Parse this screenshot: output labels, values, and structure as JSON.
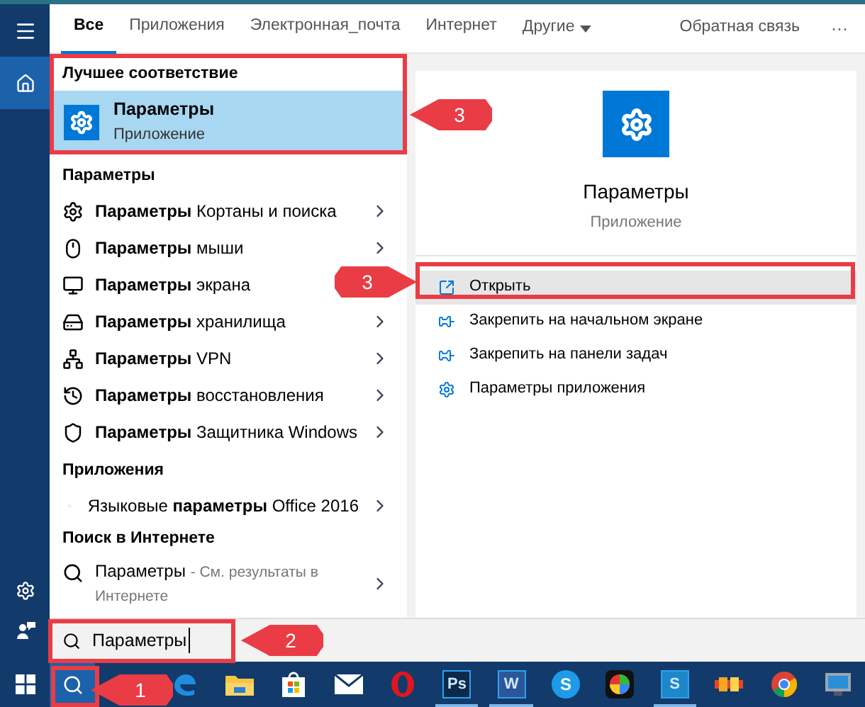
{
  "tabs": [
    {
      "label": "Все",
      "selected": true
    },
    {
      "label": "Приложения",
      "selected": false
    },
    {
      "label": "Электронная_почта",
      "selected": false
    },
    {
      "label": "Интернет",
      "selected": false
    }
  ],
  "more_tab": {
    "label": "Другие"
  },
  "feedback": {
    "label": "Обратная связь"
  },
  "overflow": {
    "label": "···"
  },
  "best_match": {
    "heading": "Лучшее соответствие",
    "title": "Параметры",
    "subtitle": "Приложение",
    "selected": true
  },
  "settings_section": {
    "heading": "Параметры",
    "items": [
      {
        "kind": "gear",
        "text": "**Параметры** Кортаны и поиска"
      },
      {
        "kind": "mouse",
        "text": "**Параметры** мыши"
      },
      {
        "kind": "monitor",
        "text": "**Параметры** экрана"
      },
      {
        "kind": "drive",
        "text": "**Параметры** хранилища"
      },
      {
        "kind": "vpn",
        "text": "**Параметры** VPN"
      },
      {
        "kind": "history",
        "text": "**Параметры** восстановления"
      },
      {
        "kind": "shield",
        "text": "**Параметры** Защитника Windows"
      }
    ]
  },
  "apps_section": {
    "heading": "Приложения",
    "items": [
      {
        "kind": "dot",
        "text": "Языковые **параметры** Office 2016"
      }
    ]
  },
  "web_section": {
    "heading": "Поиск в Интернете",
    "items": [
      {
        "kind": "search",
        "text": "Параметры",
        "hint": "- См. результаты в Интернете"
      }
    ]
  },
  "preview": {
    "title": "Параметры",
    "subtitle": "Приложение",
    "actions": [
      {
        "kind": "open",
        "label": "Открыть",
        "selected": true
      },
      {
        "kind": "pin",
        "label": "Закрепить на начальном экране",
        "selected": false
      },
      {
        "kind": "pin",
        "label": "Закрепить на панели задач",
        "selected": false
      },
      {
        "kind": "gear",
        "label": "Параметры приложения",
        "selected": false
      }
    ]
  },
  "search_box": {
    "value": "Параметры"
  },
  "taskbar": {
    "apps": [
      {
        "kind": "edge",
        "running": false
      },
      {
        "kind": "folder",
        "running": false
      },
      {
        "kind": "store",
        "running": false
      },
      {
        "kind": "mail",
        "running": false
      },
      {
        "kind": "opera",
        "running": false
      },
      {
        "kind": "tile",
        "glyph": "Ps",
        "color": "#0b2a4a",
        "running": true
      },
      {
        "kind": "tile",
        "glyph": "W",
        "color": "#2b579a",
        "running": true
      },
      {
        "kind": "round",
        "glyph": "S",
        "color": "#1e9be8",
        "running": false
      },
      {
        "kind": "wheel",
        "running": false
      },
      {
        "kind": "tile",
        "glyph": "S",
        "color": "#1c88c9",
        "running": true
      },
      {
        "kind": "bricks",
        "running": false
      },
      {
        "kind": "chrome",
        "running": false
      },
      {
        "kind": "screen",
        "running": false
      }
    ]
  },
  "callouts": [
    {
      "label": "3"
    },
    {
      "label": "3"
    },
    {
      "label": "2"
    },
    {
      "label": "1"
    }
  ]
}
